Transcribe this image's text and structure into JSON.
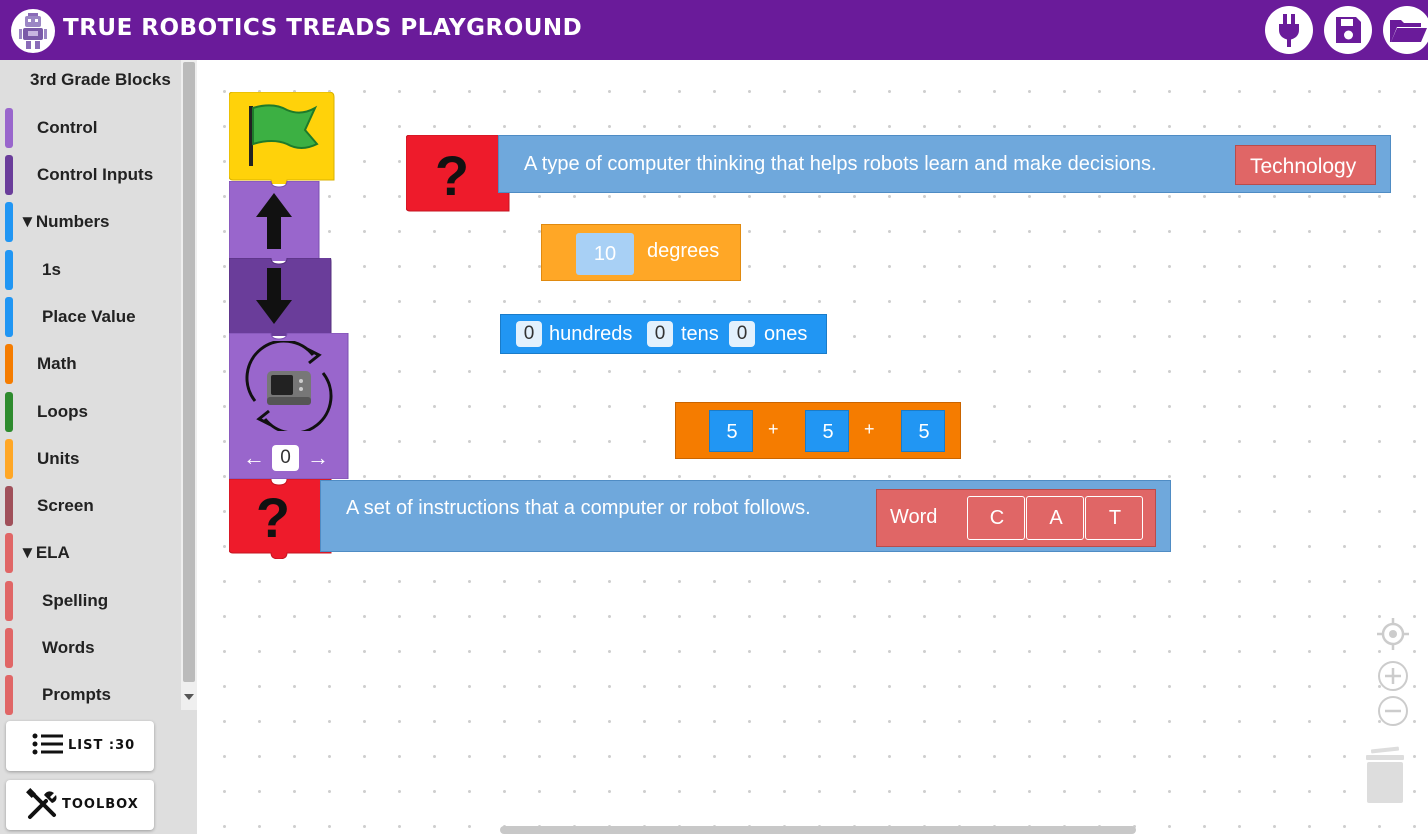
{
  "header": {
    "title": "TRUE ROBOTICS TREADS PLAYGROUND"
  },
  "sidebar": {
    "title": "3rd Grade Blocks",
    "categories": [
      {
        "label": "Control",
        "color": "#9966cc"
      },
      {
        "label": "Control Inputs",
        "color": "#6a3d9a"
      },
      {
        "label": "▼Numbers",
        "color": "#2196f3"
      },
      {
        "label": "1s",
        "color": "#2196f3"
      },
      {
        "label": "Place Value",
        "color": "#2196f3"
      },
      {
        "label": "Math",
        "color": "#f57c00"
      },
      {
        "label": "Loops",
        "color": "#2e8b2e"
      },
      {
        "label": "Units",
        "color": "#ffa726"
      },
      {
        "label": "Screen",
        "color": "#a0505a"
      },
      {
        "label": "▼ELA",
        "color": "#e06666"
      },
      {
        "label": "Spelling",
        "color": "#e06666"
      },
      {
        "label": "Words",
        "color": "#e06666"
      },
      {
        "label": "Prompts",
        "color": "#e06666"
      }
    ],
    "list_button": "LIST :30",
    "toolbox_button": "TOOLBOX"
  },
  "blocks": {
    "prompt1": {
      "text": "A type of computer thinking that helps robots learn and make decisions.",
      "answer": "Technology"
    },
    "degrees": {
      "value": "10",
      "unit": "degrees"
    },
    "place_value": {
      "hundreds_value": "0",
      "hundreds": "hundreds",
      "tens_value": "0",
      "tens": "tens",
      "ones_value": "0",
      "ones": "ones"
    },
    "math": {
      "a": "5",
      "op1": "+",
      "b": "5",
      "op2": "+",
      "c": "5"
    },
    "rotate": {
      "value": "0",
      "left_arrow": "←",
      "right_arrow": "→"
    },
    "prompt2": {
      "text": "A set of instructions that a computer or robot follows.",
      "word_label": "Word",
      "letters": [
        "C",
        "A",
        "T"
      ]
    }
  },
  "colors": {
    "header": "#6a1b9a",
    "event_yellow": "#ffd20a",
    "motion_purple": "#9966cc",
    "dark_purple": "#6a3d9a",
    "prompt_red": "#ee1b2b",
    "prompt_blue": "#6fa8dc",
    "word_red": "#e06666",
    "units_orange": "#ffa726",
    "number_blue": "#2196f3",
    "math_orange": "#f57c00"
  }
}
